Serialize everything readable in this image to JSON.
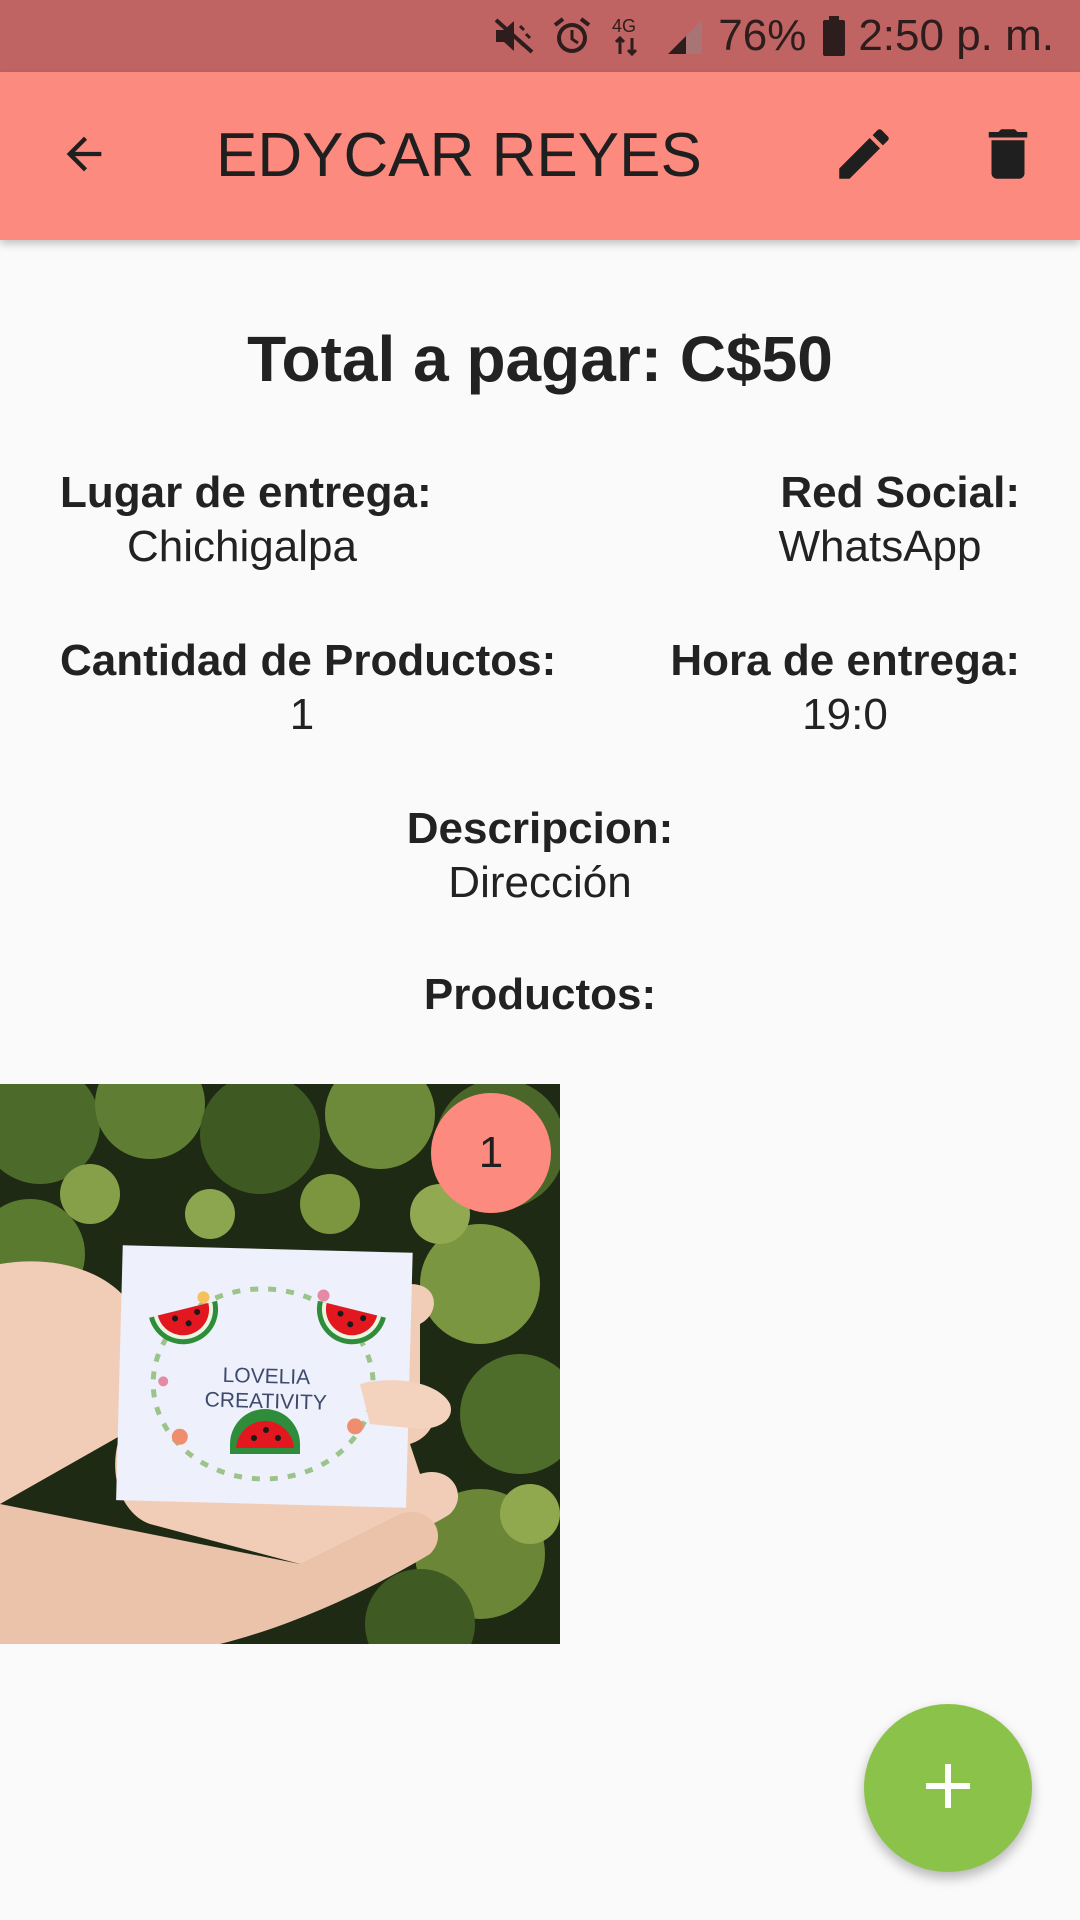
{
  "status_bar": {
    "icons": [
      "mute-icon",
      "alarm-icon",
      "network-4g-icon",
      "signal-icon",
      "battery-icon"
    ],
    "network_label": "4G",
    "battery": "76%",
    "time": "2:50 p. m."
  },
  "app_bar": {
    "title": "EDYCAR REYES",
    "back_icon": "arrow-back-icon",
    "edit_icon": "pencil-icon",
    "delete_icon": "trash-icon",
    "color": "#fd8a7e"
  },
  "order": {
    "total_label": "Total a pagar: C$50",
    "lugar": {
      "label": "Lugar de entrega:",
      "value": "Chichigalpa"
    },
    "red_social": {
      "label": "Red Social:",
      "value": "WhatsApp"
    },
    "cantidad": {
      "label": "Cantidad de Productos:",
      "value": "1"
    },
    "hora": {
      "label": "Hora de entrega:",
      "value": "19:0"
    },
    "descripcion": {
      "label": "Descripcion:",
      "value": "Dirección"
    },
    "productos_label": "Productos:"
  },
  "products": [
    {
      "quantity": "1",
      "card_text_line1": "LOVELIA",
      "card_text_line2": "CREATIVITY"
    }
  ],
  "fab": {
    "icon": "plus-icon",
    "color": "#8bc34a"
  }
}
